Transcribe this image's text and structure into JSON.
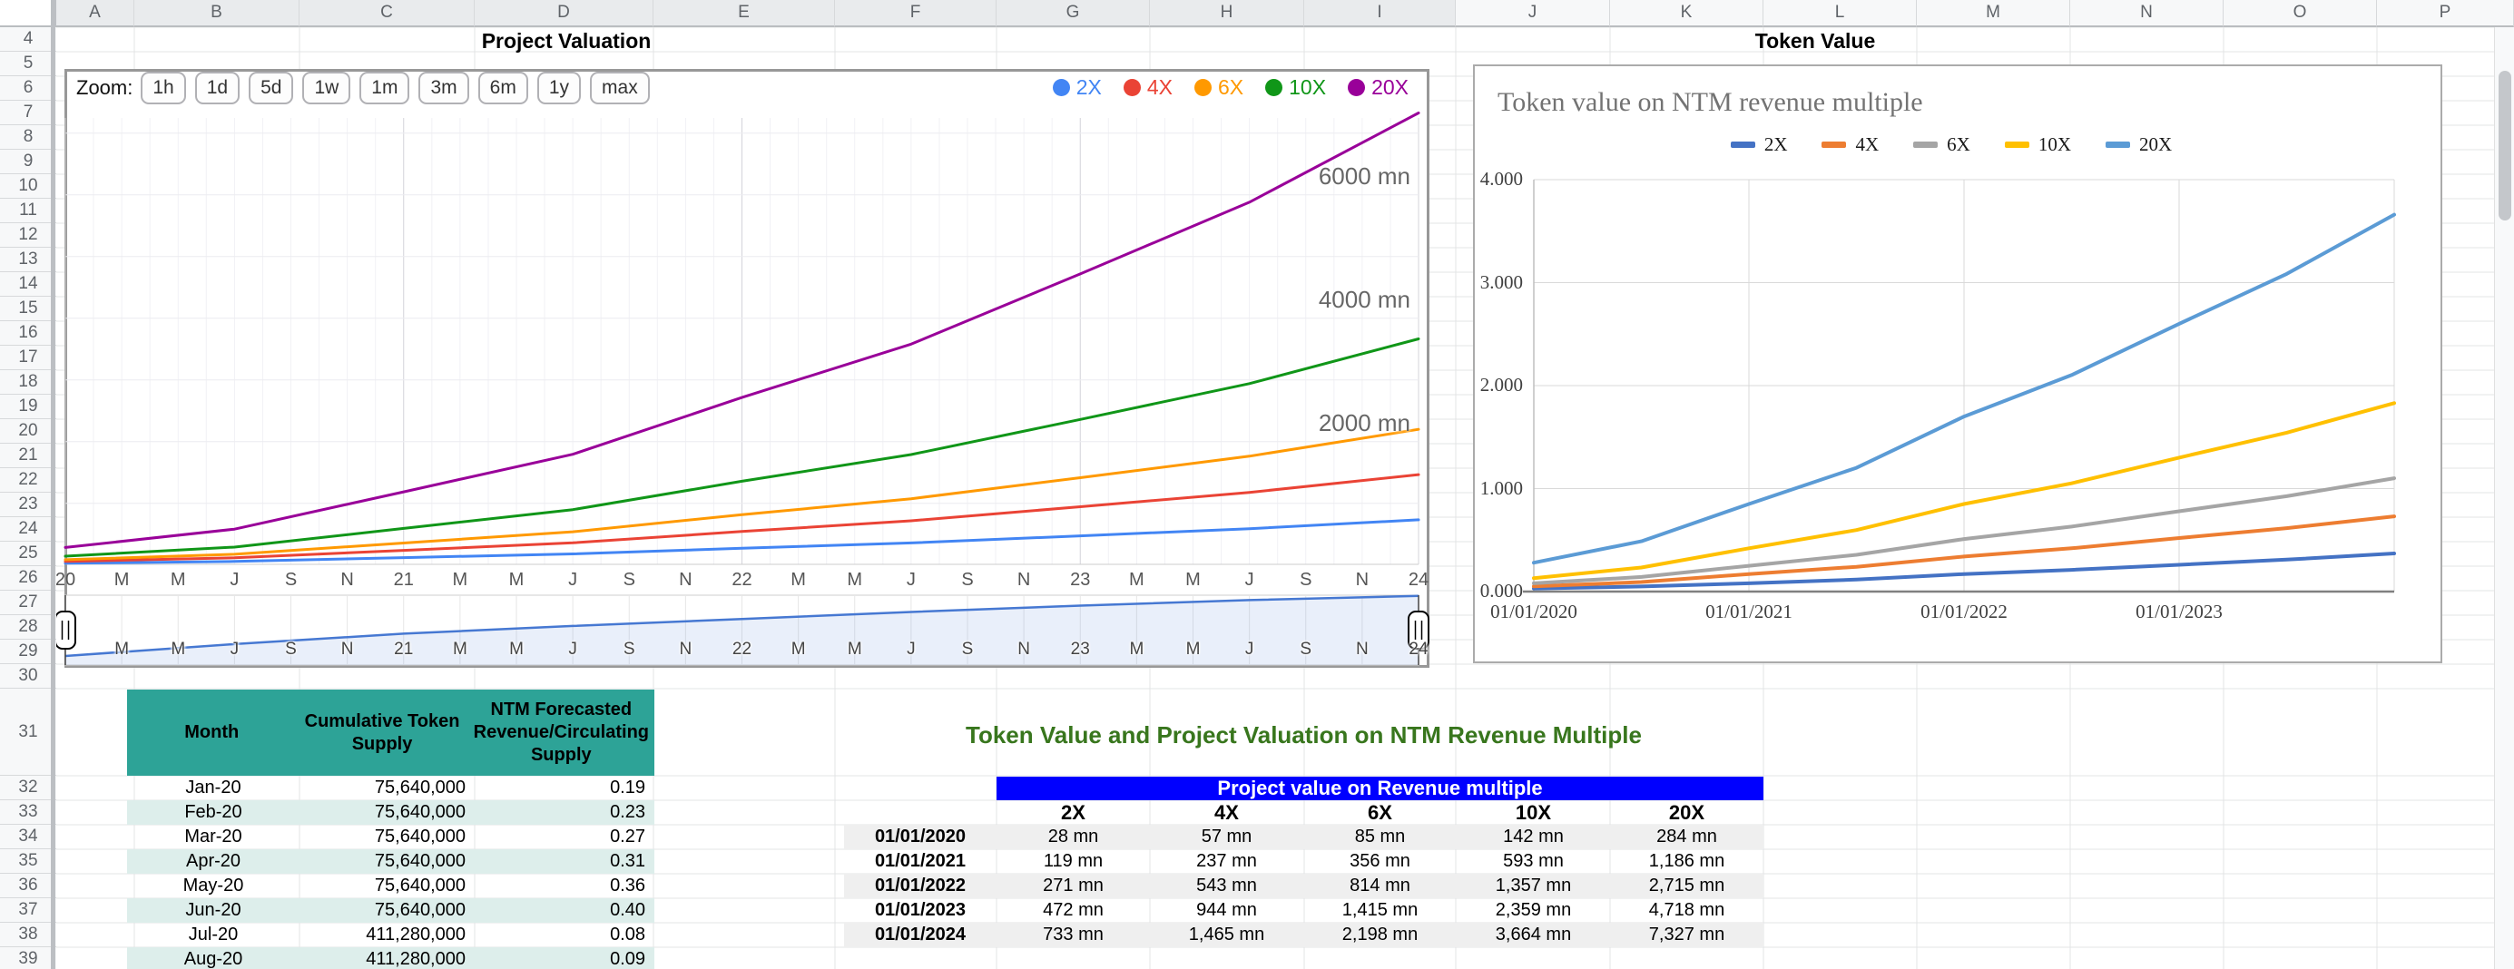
{
  "sheet": {
    "column_letters": [
      "A",
      "B",
      "C",
      "D",
      "E",
      "F",
      "G",
      "H",
      "I",
      "J",
      "K",
      "L",
      "M",
      "N",
      "O",
      "P"
    ],
    "row_numbers": [
      4,
      5,
      6,
      7,
      8,
      9,
      10,
      11,
      12,
      13,
      14,
      15,
      16,
      17,
      18,
      19,
      20,
      21,
      22,
      23,
      24,
      25,
      26,
      27,
      28,
      29,
      30,
      31,
      32,
      33,
      34,
      35,
      36,
      37,
      38,
      39
    ]
  },
  "left_chart": {
    "title": "Project Valuation",
    "zoom_label": "Zoom:",
    "zoom_buttons": [
      "1h",
      "1d",
      "5d",
      "1w",
      "1m",
      "3m",
      "6m",
      "1y",
      "max"
    ],
    "inline_y_labels": [
      {
        "text": "2000 mn",
        "value": 2000
      },
      {
        "text": "4000 mn",
        "value": 4000
      },
      {
        "text": "6000 mn",
        "value": 6000
      }
    ],
    "x_tick_labels": [
      "20",
      "M",
      "M",
      "J",
      "S",
      "N",
      "21",
      "M",
      "M",
      "J",
      "S",
      "N",
      "22",
      "M",
      "M",
      "J",
      "S",
      "N",
      "23",
      "M",
      "M",
      "J",
      "S",
      "N",
      "24"
    ],
    "navigator_labels": [
      "M",
      "M",
      "J",
      "S",
      "N",
      "21",
      "M",
      "M",
      "J",
      "S",
      "N",
      "22",
      "M",
      "M",
      "J",
      "S",
      "N",
      "23",
      "M",
      "M",
      "J",
      "S",
      "N",
      "24"
    ],
    "chart_data": {
      "type": "line",
      "x": [
        "01/01/2020",
        "01/01/2021",
        "01/01/2022",
        "01/01/2023",
        "01/01/2024"
      ],
      "unit": "mn",
      "ylim": [
        0,
        7500
      ],
      "grid": true,
      "legend_position": "top-right",
      "series": [
        {
          "name": "2X",
          "color": "#4285F4",
          "values": [
            28,
            119,
            271,
            472,
            733
          ]
        },
        {
          "name": "4X",
          "color": "#EA4335",
          "values": [
            57,
            237,
            543,
            944,
            1465
          ]
        },
        {
          "name": "6X",
          "color": "#FF9900",
          "values": [
            85,
            356,
            814,
            1415,
            2198
          ]
        },
        {
          "name": "10X",
          "color": "#109618",
          "values": [
            142,
            593,
            1357,
            2359,
            3664
          ]
        },
        {
          "name": "20X",
          "color": "#990099",
          "values": [
            284,
            1186,
            2715,
            4718,
            7327
          ]
        }
      ],
      "navigator_profile": [
        0.13,
        0.3,
        0.45,
        0.56,
        0.66,
        0.76,
        0.85,
        0.93,
        0.99
      ],
      "navigator_color": "#4678D2"
    }
  },
  "right_chart": {
    "title": "Token Value",
    "subtitle": "Token value on NTM revenue multiple",
    "y_tick_labels": [
      "0.000",
      "1.000",
      "2.000",
      "3.000",
      "4.000"
    ],
    "x_tick_labels": [
      "01/01/2020",
      "01/01/2021",
      "01/01/2022",
      "01/01/2023"
    ],
    "chart_data": {
      "type": "line",
      "x": [
        "01/01/2020",
        "01/01/2021",
        "01/01/2022",
        "01/01/2023",
        "01/01/2024"
      ],
      "ylim": [
        0,
        4
      ],
      "grid": true,
      "legend_position": "top-center",
      "series": [
        {
          "name": "2X",
          "color": "#4472C4",
          "values": [
            0.03,
            0.08,
            0.17,
            0.26,
            0.37
          ]
        },
        {
          "name": "4X",
          "color": "#ED7D31",
          "values": [
            0.05,
            0.17,
            0.34,
            0.52,
            0.73
          ]
        },
        {
          "name": "6X",
          "color": "#A5A5A5",
          "values": [
            0.08,
            0.25,
            0.51,
            0.78,
            1.1
          ]
        },
        {
          "name": "10X",
          "color": "#FFC000",
          "values": [
            0.13,
            0.42,
            0.85,
            1.3,
            1.83
          ]
        },
        {
          "name": "20X",
          "color": "#5B9BD5",
          "values": [
            0.28,
            0.85,
            1.7,
            2.6,
            3.66
          ]
        }
      ]
    }
  },
  "left_table": {
    "headers": [
      "Month",
      "Cumulative Token Supply",
      "NTM Forecasted Revenue/Circulating Supply"
    ],
    "header_bg": "#2DA397",
    "alt_row_bg": "#DDEEEB",
    "rows": [
      [
        "Jan-20",
        "75,640,000",
        "0.19"
      ],
      [
        "Feb-20",
        "75,640,000",
        "0.23"
      ],
      [
        "Mar-20",
        "75,640,000",
        "0.27"
      ],
      [
        "Apr-20",
        "75,640,000",
        "0.31"
      ],
      [
        "May-20",
        "75,640,000",
        "0.36"
      ],
      [
        "Jun-20",
        "75,640,000",
        "0.40"
      ],
      [
        "Jul-20",
        "411,280,000",
        "0.08"
      ],
      [
        "Aug-20",
        "411,280,000",
        "0.09"
      ]
    ]
  },
  "right_table": {
    "title": "Token Value and Project Valuation on NTM Revenue Multiple",
    "title_color": "#38761D",
    "banner": "Project value on Revenue multiple",
    "banner_bg": "#0000FF",
    "alt_row_bg": "#EFEFEF",
    "columns": [
      "2X",
      "4X",
      "6X",
      "10X",
      "20X"
    ],
    "rows": [
      {
        "date": "01/01/2020",
        "values": [
          "28 mn",
          "57 mn",
          "85 mn",
          "142 mn",
          "284 mn"
        ]
      },
      {
        "date": "01/01/2021",
        "values": [
          "119 mn",
          "237 mn",
          "356 mn",
          "593 mn",
          "1,186 mn"
        ]
      },
      {
        "date": "01/01/2022",
        "values": [
          "271 mn",
          "543 mn",
          "814 mn",
          "1,357 mn",
          "2,715 mn"
        ]
      },
      {
        "date": "01/01/2023",
        "values": [
          "472 mn",
          "944 mn",
          "1,415 mn",
          "2,359 mn",
          "4,718 mn"
        ]
      },
      {
        "date": "01/01/2024",
        "values": [
          "733 mn",
          "1,465 mn",
          "2,198 mn",
          "3,664 mn",
          "7,327 mn"
        ]
      }
    ]
  }
}
